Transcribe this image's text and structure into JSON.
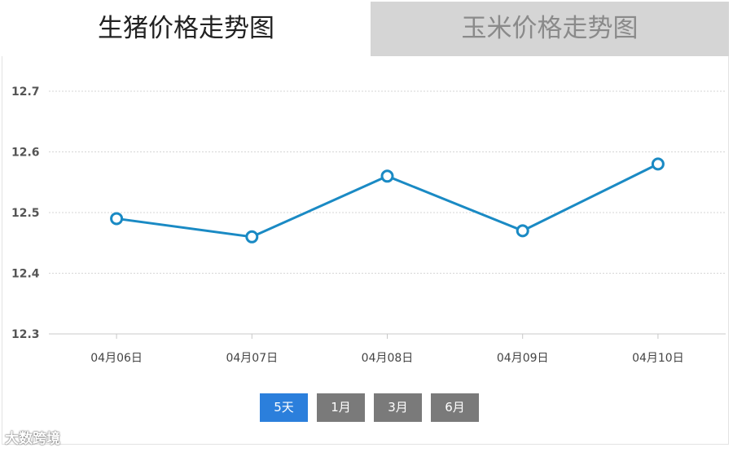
{
  "tabs": [
    {
      "label": "生猪价格走势图",
      "active": true
    },
    {
      "label": "玉米价格走势图",
      "active": false
    }
  ],
  "chart_data": {
    "type": "line",
    "categories": [
      "04月06日",
      "04月07日",
      "04月08日",
      "04月09日",
      "04月10日"
    ],
    "series": [
      {
        "values": [
          12.49,
          12.46,
          12.56,
          12.47,
          12.58
        ],
        "color": "#1a8ac4"
      }
    ],
    "ylim": [
      12.3,
      12.7
    ],
    "yticks": [
      "12.7",
      "12.6",
      "12.5",
      "12.4",
      "12.3"
    ],
    "grid": true,
    "title": "",
    "xlabel": "",
    "ylabel": ""
  },
  "range_buttons": [
    {
      "label": "5天",
      "active": true,
      "color": "#2b7fdc"
    },
    {
      "label": "1月",
      "active": false,
      "color": "#7a7a7a"
    },
    {
      "label": "3月",
      "active": false,
      "color": "#7a7a7a"
    },
    {
      "label": "6月",
      "active": false,
      "color": "#7a7a7a"
    }
  ],
  "watermark": "大数跨境"
}
